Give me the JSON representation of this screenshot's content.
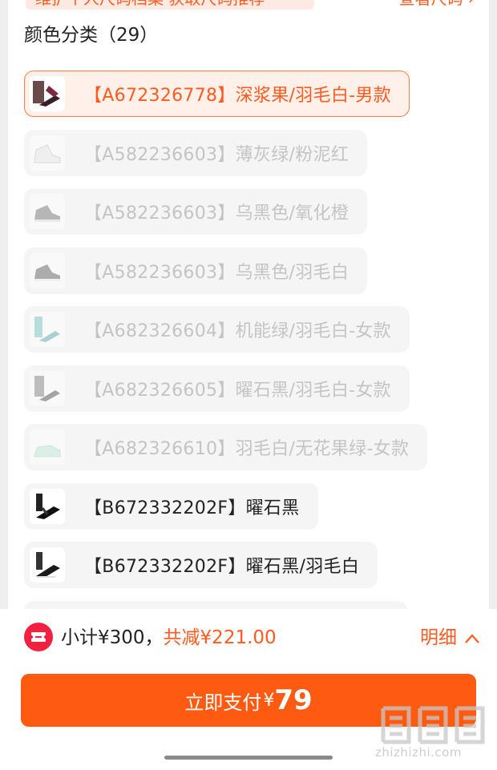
{
  "header": {
    "banner_text": "维护个人尺码档案 获取尺码推荐",
    "size_link": "查看尺码 ›"
  },
  "section": {
    "title": "颜色分类（29）"
  },
  "options": [
    {
      "label": "【A672326778】深浆果/羽毛白-男款",
      "state": "selected",
      "thumb_icon": "dark-shoe-icon"
    },
    {
      "label": "【A582236603】薄灰绿/粉泥红",
      "state": "disabled",
      "thumb_icon": "white-hightop-icon"
    },
    {
      "label": "【A582236603】乌黑色/氧化橙",
      "state": "disabled",
      "thumb_icon": "gray-hightop-icon"
    },
    {
      "label": "【A582236603】乌黑色/羽毛白",
      "state": "disabled",
      "thumb_icon": "gray-hightop-icon"
    },
    {
      "label": "【A682326604】机能绿/羽毛白-女款",
      "state": "disabled",
      "thumb_icon": "teal-shoe-icon"
    },
    {
      "label": "【A682326605】曜石黑/羽毛白-女款",
      "state": "disabled",
      "thumb_icon": "gray-shoe-icon"
    },
    {
      "label": "【A682326610】羽毛白/无花果绿-女款",
      "state": "disabled",
      "thumb_icon": "mint-shoe-icon"
    },
    {
      "label": "【B672332202F】曜石黑",
      "state": "available",
      "thumb_icon": "black-shoe-icon"
    },
    {
      "label": "【B672332202F】曜石黑/羽毛白",
      "state": "available",
      "thumb_icon": "black-white-shoe-icon"
    }
  ],
  "summary": {
    "subtotal": "小计¥300，",
    "discount": "共减¥221.00",
    "detail_label": "明细"
  },
  "pay": {
    "label": "立即支付",
    "currency": "¥",
    "amount": "79"
  },
  "watermark": {
    "url": "zhizhizhi.com"
  },
  "colors": {
    "accent": "#ff5a1f",
    "pay_button": "#ff5a12",
    "coupon_icon": "#f5203f",
    "selected_bg": "#fff1e9",
    "disabled_text": "#c4c4c4"
  }
}
